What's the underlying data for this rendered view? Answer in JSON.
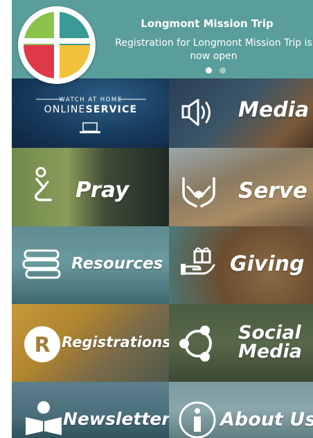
{
  "banner": {
    "title": "Longmont Mission Trip",
    "subtitle": "Registration for Longmont Mission Trip is now open"
  },
  "tiles": {
    "online_service": {
      "top_text": "WATCH AT HOME",
      "brand_left": "ONLINE",
      "brand_right": "SERVICE"
    },
    "media": {
      "label": "Media"
    },
    "pray": {
      "label": "Pray"
    },
    "serve": {
      "label": "Serve"
    },
    "resources": {
      "label": "Resources"
    },
    "giving": {
      "label": "Giving"
    },
    "registrations": {
      "label": "Registrations"
    },
    "social_media": {
      "label_line1": "Social",
      "label_line2": "Media"
    },
    "newsletter": {
      "label": "Newsletter"
    },
    "about_us": {
      "label": "About Us"
    }
  },
  "colors": {
    "banner_teal": "#5a9e9b",
    "logo_green": "#8bc34a",
    "logo_teal": "#3a9a96",
    "logo_red": "#e0384b",
    "logo_yellow": "#f2c23a"
  },
  "icons": {
    "media": "speaker-icon",
    "pray": "praying-person-icon",
    "serve": "helping-hands-icon",
    "resources": "books-icon",
    "giving": "gift-hand-icon",
    "registrations": "registration-r-icon",
    "social_media": "share-network-icon",
    "newsletter": "reader-icon",
    "about_us": "info-icon"
  }
}
